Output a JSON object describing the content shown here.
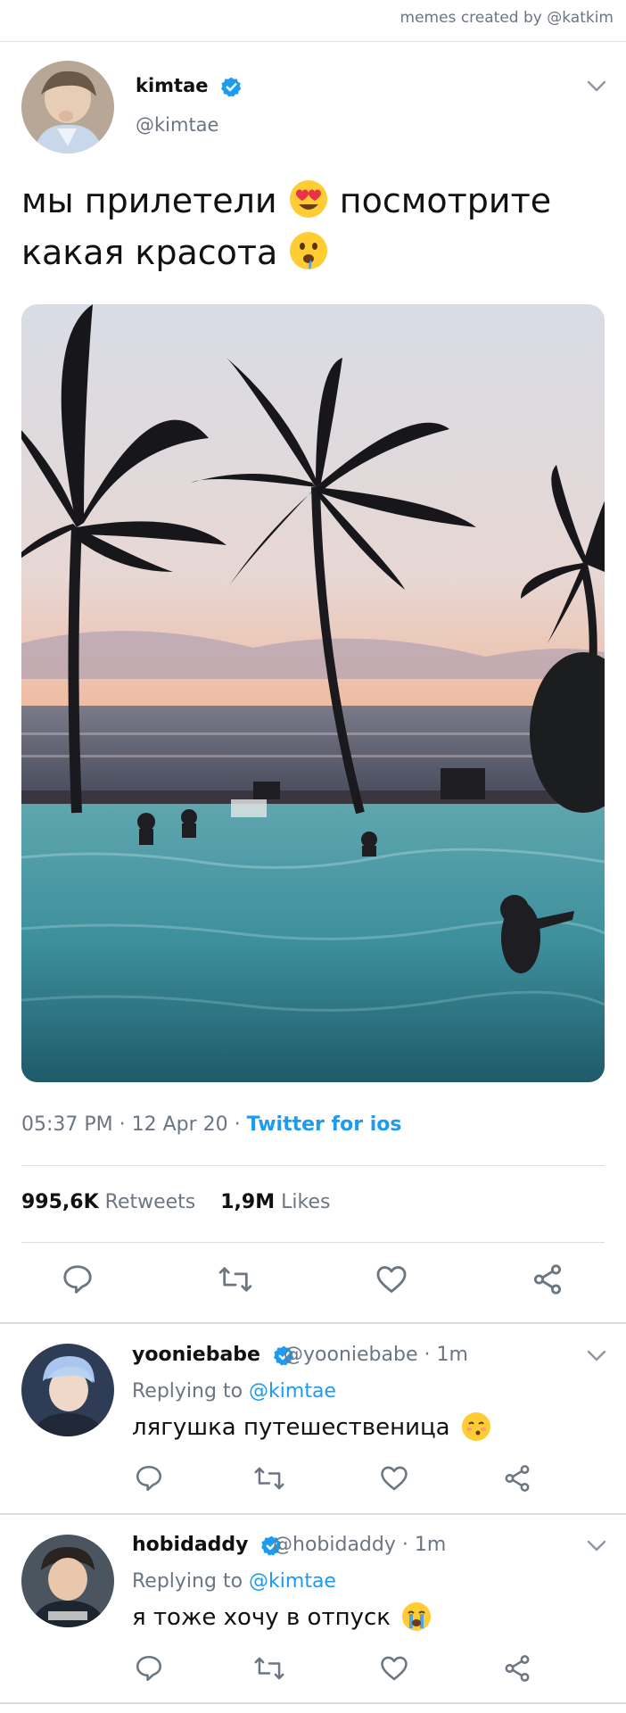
{
  "credit": "memes created by @katkim",
  "tweet": {
    "name": "kimtae",
    "handle": "@kimtae",
    "text_line1": "мы прилетели",
    "text_line1b": "посмотрите",
    "text_line2": "какая красота",
    "time": "05:37 PM · 12 Apr 20 · ",
    "client": "Twitter for ios",
    "retweets_count": "995,6K",
    "retweets_label": "Retweets",
    "likes_count": "1,9M",
    "likes_label": "Likes"
  },
  "replies": [
    {
      "name": "yooniebabe",
      "handle_time": "@yooniebabe · 1m",
      "replying_prefix": "Replying to ",
      "replying_to": "@kimtae",
      "text": "лягушка путешественица",
      "emoji": "kissing-face-emoji"
    },
    {
      "name": "hobidaddy",
      "handle_time": "@hobidaddy · 1m",
      "replying_prefix": "Replying to ",
      "replying_to": "@kimtae",
      "text": "я тоже хочу в отпуск",
      "emoji": "crying-face-emoji"
    }
  ],
  "colors": {
    "accent": "#1d9bf0",
    "muted": "#6b7682",
    "divider": "#d9dee2"
  }
}
